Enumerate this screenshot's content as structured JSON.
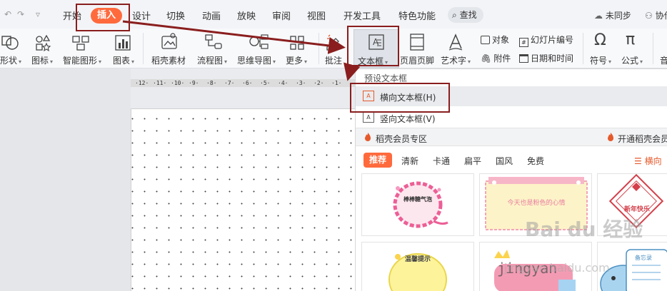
{
  "menubar": {
    "tabs": [
      "开始",
      "插入",
      "设计",
      "切换",
      "动画",
      "放映",
      "审阅",
      "视图",
      "开发工具",
      "特色功能"
    ],
    "active_tab": "插入",
    "search": "查找",
    "sync_status": "未同步",
    "collab": "协作"
  },
  "ribbon": {
    "shape": "形状",
    "icons": "图标",
    "smart_art": "智能图形",
    "chart": "图表",
    "material": "稻壳素材",
    "flowchart": "流程图",
    "mindmap": "思维导图",
    "more": "更多",
    "comment": "批注",
    "textbox": "文本框",
    "header_footer": "页眉页脚",
    "wordart": "艺术字",
    "object": "对象",
    "slide_number": "幻灯片编号",
    "attachment": "附件",
    "date_time": "日期和时间",
    "symbol": "符号",
    "formula": "公式",
    "audio": "音"
  },
  "ruler": [
    "12",
    "11",
    "10",
    "9",
    "8",
    "7",
    "6",
    "5",
    "4",
    "3",
    "2",
    "1"
  ],
  "dropdown": {
    "header": "预设文本框",
    "items": [
      {
        "icon": "A",
        "label": "横向文本框(H)"
      },
      {
        "icon": "A",
        "label": "竖向文本框(V)"
      }
    ],
    "member_title": "稻壳会员专区",
    "member_open": "开通稻壳会员",
    "tabs": [
      "推荐",
      "清新",
      "卡通",
      "扁平",
      "国风",
      "免费"
    ],
    "orientation": "横向",
    "cards": [
      {
        "text": "棒棒糖气泡"
      },
      {
        "text": "今天也是粉色的心情"
      },
      {
        "text": "新年快乐"
      },
      {
        "text": "温馨提示"
      },
      {
        "text": "jingyan"
      },
      {
        "text": "备忘录"
      }
    ]
  },
  "watermark": {
    "brand": "Bai du 经验",
    "sub": "jingyan.baidu.com"
  }
}
